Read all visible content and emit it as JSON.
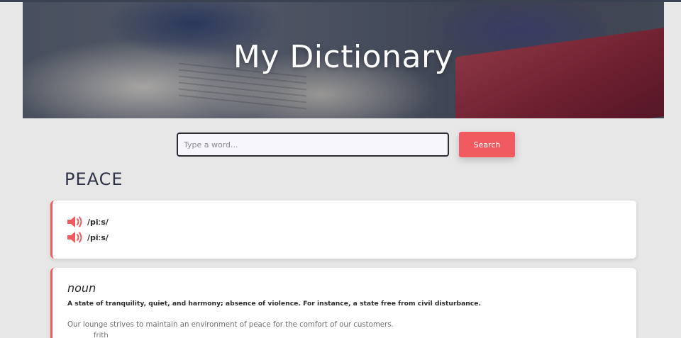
{
  "app": {
    "title": "My Dictionary"
  },
  "search": {
    "placeholder": "Type a word...",
    "value": "",
    "button_label": "Search"
  },
  "word": {
    "title": "PEACE"
  },
  "phonetics": [
    {
      "text": "/piːs/",
      "icon": "speaker-icon"
    },
    {
      "text": "/piːs/",
      "icon": "speaker-icon"
    }
  ],
  "meanings": [
    {
      "part_of_speech": "noun",
      "definition": "A state of tranquility, quiet, and harmony; absence of violence. For instance, a state free from civil disturbance.",
      "example": "Our lounge strives to maintain an environment of peace for the comfort of our customers.",
      "synonyms": [
        "frith"
      ]
    }
  ],
  "colors": {
    "accent": "#f15a5e",
    "background": "#e7e7e8",
    "title_text": "#2e3446"
  }
}
